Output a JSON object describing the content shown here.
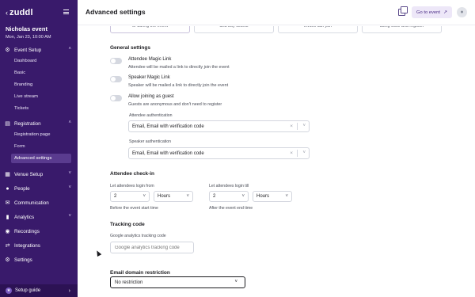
{
  "sidebar": {
    "logo": "zuddl",
    "back_icon": "chevron-left-icon",
    "menu_icon": "hamburger-menu-icon",
    "event_name": "Nicholas event",
    "event_date": "Mon, Jan 23, 10:00 AM",
    "groups": {
      "event_setup": "Event Setup",
      "registration": "Registration",
      "venue_setup": "Venue Setup",
      "people": "People",
      "communication": "Communication",
      "analytics": "Analytics",
      "recordings": "Recordings",
      "integrations": "Integrations",
      "settings": "Settings"
    },
    "event_setup_items": [
      "Dashboard",
      "Basic",
      "Branding",
      "Live stream",
      "Tickets"
    ],
    "registration_items": [
      "Registration page",
      "Form",
      "Advanced settings"
    ],
    "setup_guide": "Setup guide"
  },
  "header": {
    "title": "Advanced settings",
    "go_to_event": "Go to event"
  },
  "cards": [
    "or during the event",
    "and buy tickets",
    "invites can join",
    "using SSO and register"
  ],
  "general_settings": {
    "title": "General settings",
    "attendee_magic_link": "Attendee Magic Link",
    "attendee_magic_link_desc": "Attendee will be mailed a link to directly join the event",
    "speaker_magic_link": "Speaker Magic Link",
    "speaker_magic_link_desc": "Speaker will be mailed a link to directly join the event",
    "allow_guest": "Allow joining as guest",
    "allow_guest_desc": "Guests are anonymous and don't need to register",
    "attendee_auth_label": "Attendee authentication",
    "attendee_auth_value": "Email, Email with verification code",
    "speaker_auth_label": "Speaker authentication",
    "speaker_auth_value": "Email, Email with verification code"
  },
  "attendee_checkin": {
    "title": "Attendee check-in",
    "login_from_label": "Let attendees login from",
    "login_from_value": "2",
    "login_from_unit": "Hours",
    "login_from_hint": "Before the event start time",
    "login_till_label": "Let attendees login till",
    "login_till_value": "2",
    "login_till_unit": "Hours",
    "login_till_hint": "After the event end time"
  },
  "tracking": {
    "title": "Tracking code",
    "ga_label": "Google analytics tracking code",
    "ga_placeholder": "Google analytics tracking code"
  },
  "email_domain": {
    "title": "Email domain restriction",
    "value": "No restriction"
  },
  "colors": {
    "sidebar_bg": "#391a6b",
    "active_item_bg": "#5a3b8f",
    "accent_button_bg": "#ede7f8"
  }
}
